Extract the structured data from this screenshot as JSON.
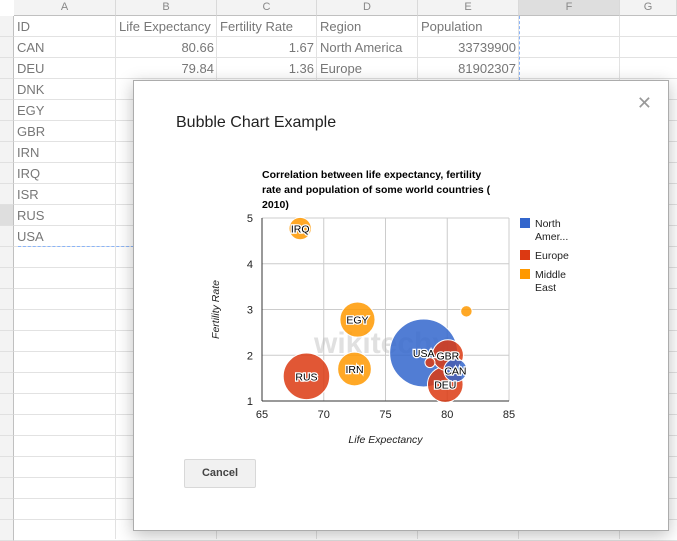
{
  "spreadsheet": {
    "column_headers": [
      "A",
      "B",
      "C",
      "D",
      "E",
      "F",
      "G"
    ],
    "header_row": [
      "ID",
      "Life Expectancy",
      "Fertility Rate",
      "Region",
      "Population"
    ],
    "visible_rows": [
      [
        "CAN",
        "80.66",
        "1.67",
        "North America",
        "33739900"
      ],
      [
        "DEU",
        "79.84",
        "1.36",
        "Europe",
        "81902307"
      ]
    ],
    "visible_ids": [
      "DNK",
      "EGY",
      "GBR",
      "IRN",
      "IRQ",
      "ISR",
      "RUS",
      "USA"
    ]
  },
  "dialog": {
    "title": "Bubble Chart Example",
    "close_icon": "close-icon",
    "cancel_label": "Cancel"
  },
  "chart_data": {
    "type": "scatter",
    "subtype": "bubble",
    "title": "Correlation between life expectancy, fertility rate and population of some world countries (2010)",
    "title_lines": [
      "Correlation between life expectancy, fertility",
      "rate and population of some world countries (",
      "2010)"
    ],
    "xlabel": "Life Expectancy",
    "ylabel": "Fertility Rate",
    "xlim": [
      65,
      85
    ],
    "ylim": [
      1,
      5
    ],
    "xticks": [
      65,
      70,
      75,
      80,
      85
    ],
    "yticks": [
      1,
      2,
      3,
      4,
      5
    ],
    "grid": true,
    "legend_position": "right",
    "legend": [
      {
        "label_lines": [
          "North",
          "Amer..."
        ],
        "name": "North America",
        "color": "#3366cc"
      },
      {
        "label_lines": [
          "Europe"
        ],
        "name": "Europe",
        "color": "#dc3912"
      },
      {
        "label_lines": [
          "Middle",
          "East"
        ],
        "name": "Middle East",
        "color": "#ff9900"
      }
    ],
    "points": [
      {
        "id": "CAN",
        "x": 80.66,
        "y": 1.67,
        "region": "North America",
        "size": 33739900,
        "label": "CAN"
      },
      {
        "id": "DEU",
        "x": 79.84,
        "y": 1.36,
        "region": "Europe",
        "size": 81902307,
        "label": "DEU"
      },
      {
        "id": "DNK",
        "x": 78.6,
        "y": 1.84,
        "region": "Europe",
        "size": 5523095,
        "label": ""
      },
      {
        "id": "EGY",
        "x": 72.73,
        "y": 2.78,
        "region": "Middle East",
        "size": 79716203,
        "label": "EGY"
      },
      {
        "id": "GBR",
        "x": 80.05,
        "y": 2.0,
        "region": "Europe",
        "size": 61801570,
        "label": "GBR"
      },
      {
        "id": "IRN",
        "x": 72.49,
        "y": 1.7,
        "region": "Middle East",
        "size": 73137148,
        "label": "IRN"
      },
      {
        "id": "IRQ",
        "x": 68.09,
        "y": 4.77,
        "region": "Middle East",
        "size": 31090763,
        "label": "IRQ"
      },
      {
        "id": "ISR",
        "x": 81.55,
        "y": 2.96,
        "region": "Middle East",
        "size": 7485600,
        "label": ""
      },
      {
        "id": "RUS",
        "x": 68.6,
        "y": 1.54,
        "region": "Europe",
        "size": 141850000,
        "label": "RUS"
      },
      {
        "id": "USA",
        "x": 78.09,
        "y": 2.05,
        "region": "North America",
        "size": 307007000,
        "label": "USA"
      }
    ],
    "watermark": "wikitechy"
  }
}
